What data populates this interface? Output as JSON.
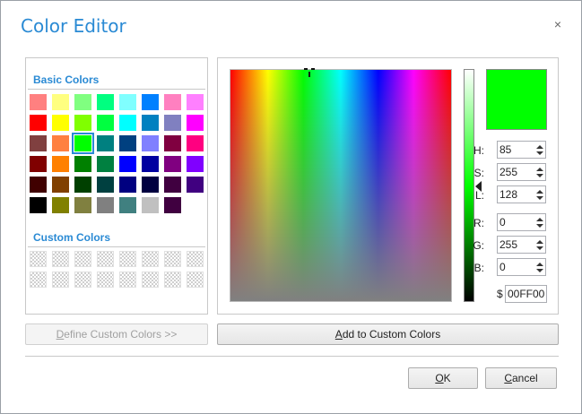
{
  "window": {
    "title": "Color Editor",
    "close_glyph": "×"
  },
  "basic_colors": {
    "title": "Basic Colors",
    "rows": [
      [
        "#ff8080",
        "#ffff80",
        "#80ff80",
        "#00ff80",
        "#80ffff",
        "#0080ff",
        "#ff80c0",
        "#ff80ff"
      ],
      [
        "#ff0000",
        "#ffff00",
        "#80ff00",
        "#00ff40",
        "#00ffff",
        "#0080c0",
        "#8080c0",
        "#ff00ff"
      ],
      [
        "#804040",
        "#ff8040",
        "#00ff00",
        "#008080",
        "#004080",
        "#8080ff",
        "#800040",
        "#ff0080"
      ],
      [
        "#800000",
        "#ff8000",
        "#008000",
        "#008040",
        "#0000ff",
        "#0000a0",
        "#800080",
        "#8000ff"
      ],
      [
        "#400000",
        "#804000",
        "#004000",
        "#004040",
        "#000080",
        "#000040",
        "#400040",
        "#400080"
      ],
      [
        "#000000",
        "#808000",
        "#808040",
        "#808080",
        "#408080",
        "#c0c0c0",
        "#400040"
      ]
    ],
    "selected": {
      "row": 2,
      "col": 2
    }
  },
  "custom_colors": {
    "title": "Custom Colors",
    "rows": 2,
    "cols": 8
  },
  "preview_color": "#00ff00",
  "fields": {
    "h": {
      "label": "H:",
      "value": "85"
    },
    "s": {
      "label": "S:",
      "value": "255"
    },
    "l": {
      "label": "L:",
      "value": "128"
    },
    "r": {
      "label": "R:",
      "value": "0"
    },
    "g": {
      "label": "G:",
      "value": "255"
    },
    "b": {
      "label": "B:",
      "value": "0"
    }
  },
  "hex": {
    "prefix": "$",
    "value": "00FF00"
  },
  "buttons": {
    "define_custom_pre": "D",
    "define_custom_rest": "efine Custom Colors >>",
    "add_custom_pre": "A",
    "add_custom_rest": "dd to Custom Colors",
    "ok_pre": "O",
    "ok_rest": "K",
    "cancel_pre": "C",
    "cancel_rest": "ancel"
  },
  "icons": {
    "close": "close-icon",
    "spin_up": "spin-up-icon",
    "spin_down": "spin-down-icon",
    "luminance_pointer": "triangle-pointer-icon",
    "spectrum_cursor": "crosshair-icon"
  }
}
